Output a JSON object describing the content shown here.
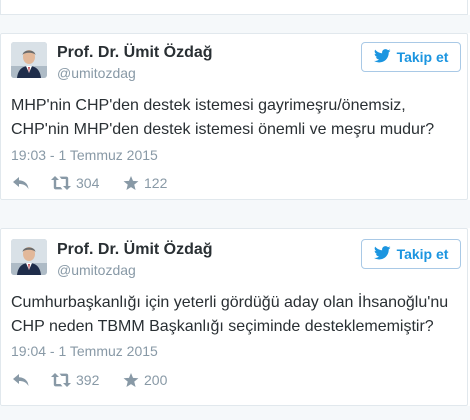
{
  "tweets": [
    {
      "author": {
        "name": "Prof. Dr. Ümit Özdağ",
        "handle": "@umitozdag"
      },
      "follow_label": "Takip et",
      "text_lines": [
        "MHP'nin CHP'den destek istemesi gayrimeşru/önemsiz,",
        "CHP'nin MHP'den destek istemesi önemli ve meşru mudur?"
      ],
      "time": "19:03 - 1 Temmuz 2015",
      "retweets": "304",
      "likes": "122"
    },
    {
      "author": {
        "name": "Prof. Dr. Ümit Özdağ",
        "handle": "@umitozdag"
      },
      "follow_label": "Takip et",
      "text_lines": [
        "Cumhurbaşkanlığı için yeterli gördüğü aday olan İhsanoğlu'nu",
        "CHP neden TBMM Başkanlığı seçiminde desteklememiştir?"
      ],
      "time": "19:04 - 1 Temmuz 2015",
      "retweets": "392",
      "likes": "200"
    }
  ],
  "colors": {
    "text": "#292f33",
    "muted": "#8899a6",
    "accent": "#1b95e0",
    "border": "#e1e8ed"
  },
  "icons": [
    "reply-icon",
    "retweet-icon",
    "like-star-icon",
    "twitter-bird-icon"
  ]
}
